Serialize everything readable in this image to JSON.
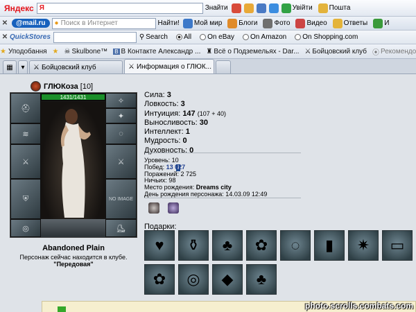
{
  "toolbar_yandex": {
    "logo_text": "Яндекс",
    "search_logo": "Я",
    "find_label": "Знайти",
    "exit_label": "Увійти",
    "mail_label": "Пошта"
  },
  "toolbar_mailru": {
    "logo_text": "@mail.ru",
    "search_placeholder": "Поиск в Интернет",
    "find_label": "Найти!",
    "items": [
      "Мой мир",
      "Блоги",
      "Фото",
      "Видео",
      "Ответы",
      "И"
    ]
  },
  "toolbar_quickstores": {
    "logo_text": "QuickStores",
    "search_label": "Search",
    "options": [
      "All",
      "On eBay",
      "On Amazon",
      "On Shopping.com"
    ],
    "selected": "All"
  },
  "bookmarks": {
    "favorites_label": "Уподобання",
    "items": [
      "Skulbone™",
      "В Контакте  Александр ...",
      "Всё о Подземельях - Dar...",
      "Бойцовский клуб",
      "Рекомендован"
    ]
  },
  "tabs": [
    {
      "label": "Бойцовский клуб",
      "active": false
    },
    {
      "label": "Информация о ГЛЮК...",
      "active": true
    }
  ],
  "character": {
    "name": "ГЛЮКоза",
    "level": "[10]",
    "info_badge": "i",
    "hp": "1431/1431",
    "no_image": "NO IMAGE",
    "location_title": "Abandoned Plain",
    "location_line": "Персонаж сейчас находится в клубе.",
    "location_hall": "\"Передовая\""
  },
  "stats": [
    {
      "label": "Сила:",
      "value": "3",
      "extra": ""
    },
    {
      "label": "Ловкость:",
      "value": "3",
      "extra": ""
    },
    {
      "label": "Интуиция:",
      "value": "147",
      "extra": "(107 + 40)"
    },
    {
      "label": "Выносливость:",
      "value": "30",
      "extra": ""
    },
    {
      "label": "Интеллект:",
      "value": "1",
      "extra": ""
    },
    {
      "label": "Мудрость:",
      "value": "0",
      "extra": ""
    },
    {
      "label": "Духовность:",
      "value": "0",
      "extra": ""
    }
  ],
  "info": {
    "level": "Уровень: 10",
    "wins_label": "Побед:",
    "wins_value": "13 027",
    "losses": "Поражений: 2 725",
    "draws": "Ничьих: 98",
    "birthplace_label": "Место рождения:",
    "birthplace_value": "Dreams city",
    "birthday": "День рождения персонажа: 14.03.09 12:49"
  },
  "gifts_label": "Подарки:",
  "gifts": [
    "heart-pendant-icon",
    "potion-bottle-icon",
    "blue-mushroom-icon",
    "pink-flower-icon",
    "pearl-necklace-icon",
    "green-bottle-icon",
    "mace-icon",
    "ruler-scroll-icon",
    "pink-flower-icon",
    "target-shield-icon",
    "green-gem-icon",
    "blue-mushroom-icon"
  ],
  "watermark": "photo.scrolls.combats.com",
  "colors": {
    "hp_bar": "#1b8f2a",
    "link": "#1f3f8f",
    "page_bg": "#dfe3e8"
  }
}
